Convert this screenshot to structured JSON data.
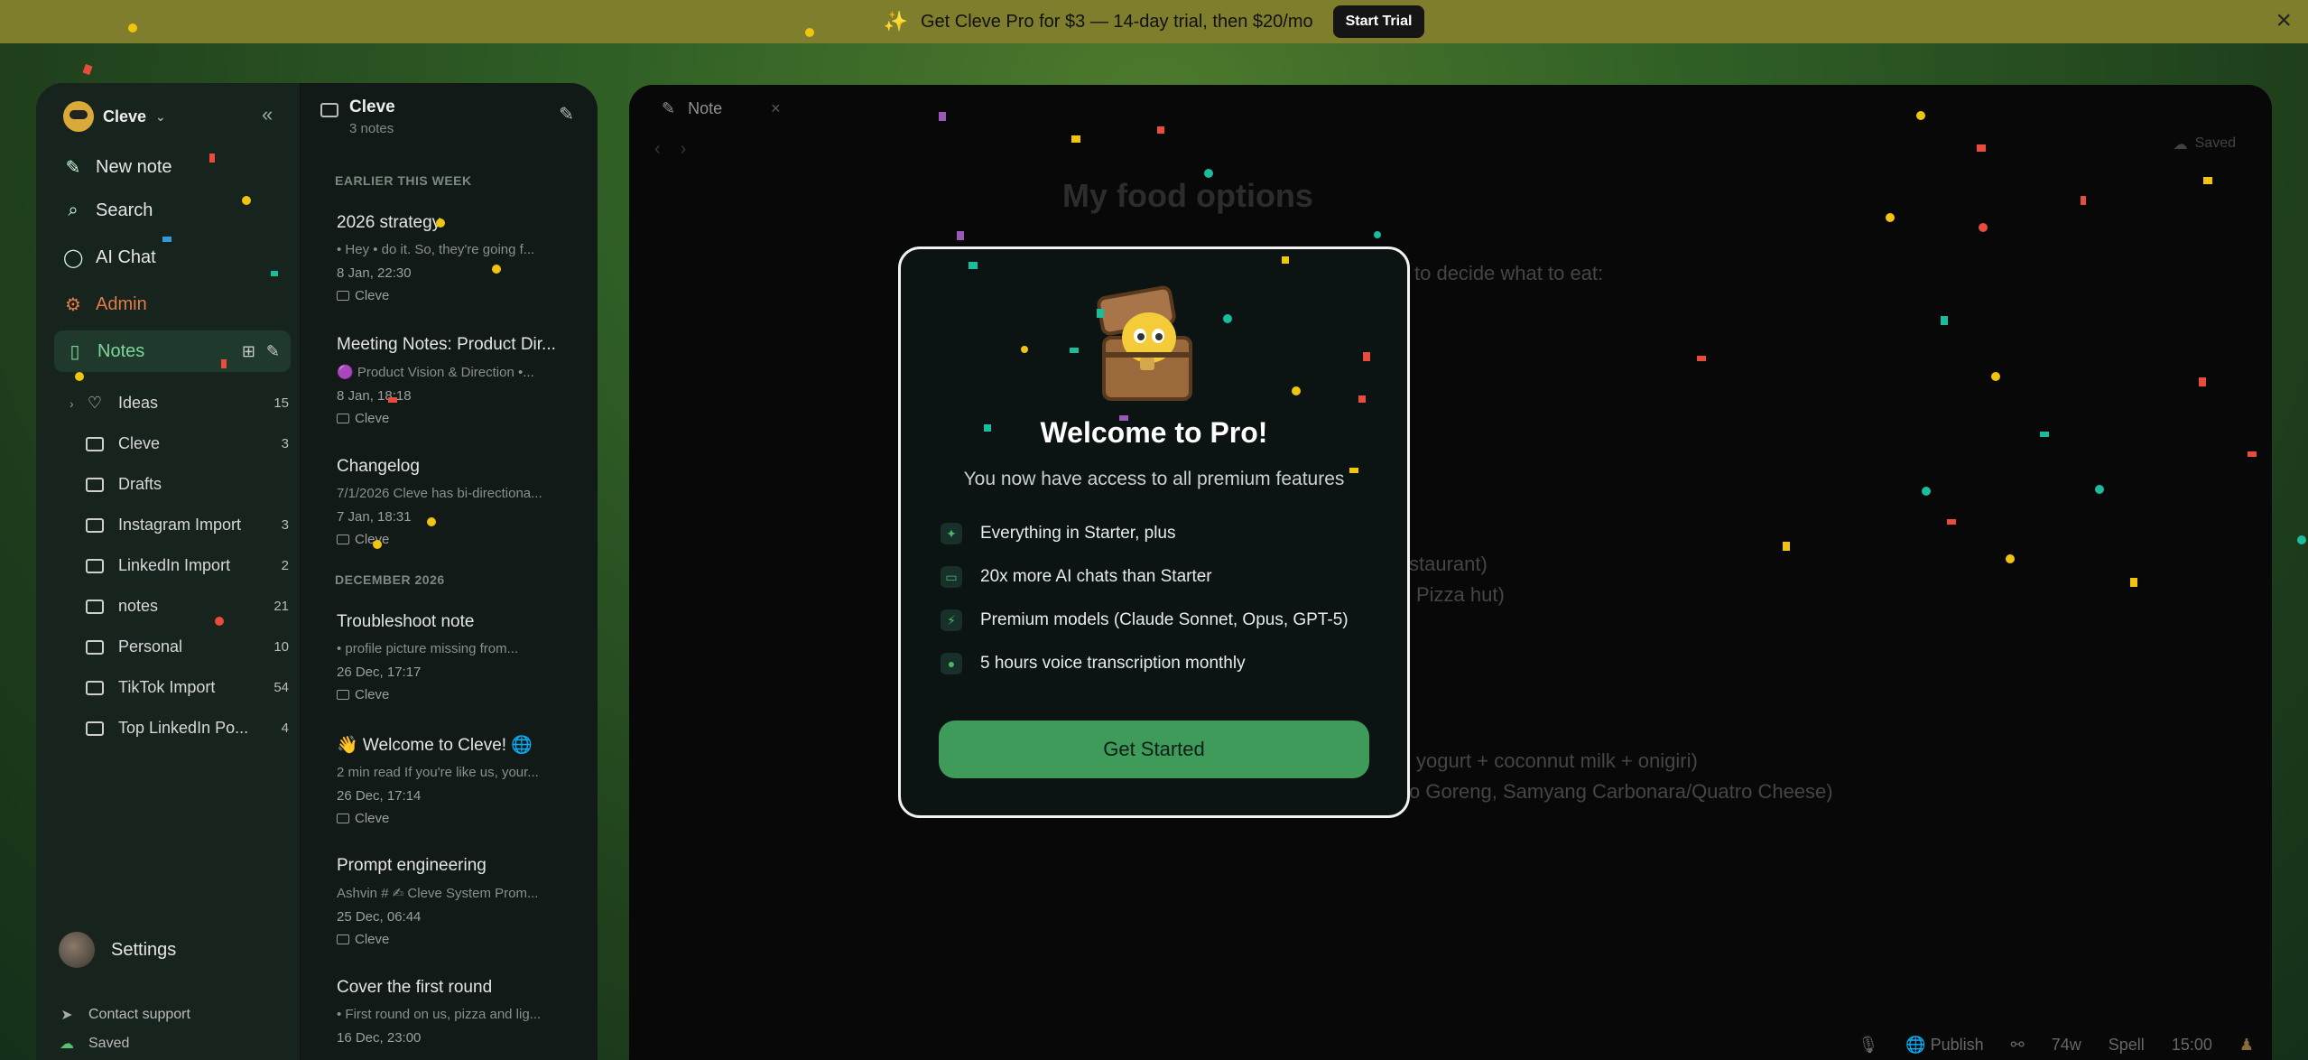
{
  "banner": {
    "text": "Get Cleve Pro for $3 — 14-day trial, then $20/mo",
    "button": "Start Trial"
  },
  "sidebar": {
    "workspace": "Cleve",
    "nav": {
      "new_note": "New note",
      "search": "Search",
      "ai_chat": "AI Chat",
      "admin": "Admin",
      "notes": "Notes"
    },
    "folders": [
      {
        "name": "Ideas",
        "count": "15"
      },
      {
        "name": "Cleve",
        "count": "3"
      },
      {
        "name": "Drafts",
        "count": ""
      },
      {
        "name": "Instagram Import",
        "count": "3"
      },
      {
        "name": "LinkedIn Import",
        "count": "2"
      },
      {
        "name": "notes",
        "count": "21"
      },
      {
        "name": "Personal",
        "count": "10"
      },
      {
        "name": "TikTok Import",
        "count": "54"
      },
      {
        "name": "Top LinkedIn Po...",
        "count": "4"
      }
    ],
    "settings": "Settings",
    "contact": "Contact support",
    "saved": "Saved"
  },
  "notes_panel": {
    "title": "Cleve",
    "subtitle": "3 notes",
    "sections": {
      "week": "EARLIER THIS WEEK",
      "dec": "DECEMBER 2026"
    },
    "notes": [
      {
        "title": "2026 strategy",
        "preview": "• Hey • do it. So, they're going f...",
        "date": "8 Jan, 22:30",
        "folder": "Cleve"
      },
      {
        "title": "Meeting Notes: Product Dir...",
        "preview": "🟣 Product Vision & Direction •...",
        "date": "8 Jan, 18:18",
        "folder": "Cleve"
      },
      {
        "title": "Changelog",
        "preview": "7/1/2026 Cleve has bi-directiona...",
        "date": "7 Jan, 18:31",
        "folder": "Cleve"
      },
      {
        "title": "Troubleshoot note",
        "preview": "• profile picture missing from...",
        "date": "26 Dec, 17:17",
        "folder": "Cleve"
      },
      {
        "title": "👋 Welcome to Cleve! 🌐",
        "preview": "2 min read If you're like us, your...",
        "date": "26 Dec, 17:14",
        "folder": "Cleve"
      },
      {
        "title": "Prompt engineering",
        "preview": "Ashvin # ✍ Cleve System Prom...",
        "date": "25 Dec, 06:44",
        "folder": "Cleve"
      },
      {
        "title": "Cover the first round",
        "preview": "• First round on us, pizza and lig...",
        "date": "16 Dec, 23:00",
        "folder": ""
      }
    ]
  },
  "editor": {
    "tab": "Note",
    "saved": "Saved",
    "title": "My food options",
    "lines": [
      "to decide what to eat:",
      "staurant)",
      "Pizza hut)",
      "yogurt + coconnut milk + onigiri)",
      "o Goreng, Samyang Carbonara/Quatro Cheese)"
    ],
    "status": {
      "publish": "Publish",
      "words": "74w",
      "spell": "Spell",
      "time": "15:00"
    }
  },
  "modal": {
    "title": "Welcome to Pro!",
    "subtitle": "You now have access to all premium features",
    "features": [
      "Everything in Starter, plus",
      "20x more AI chats than Starter",
      "Premium models (Claude Sonnet, Opus, GPT-5)",
      "5 hours voice transcription monthly"
    ],
    "button": "Get Started"
  },
  "colors": {
    "banner": "#7e7e2c",
    "accent": "#3e9b5a",
    "admin": "#e07b4a"
  }
}
